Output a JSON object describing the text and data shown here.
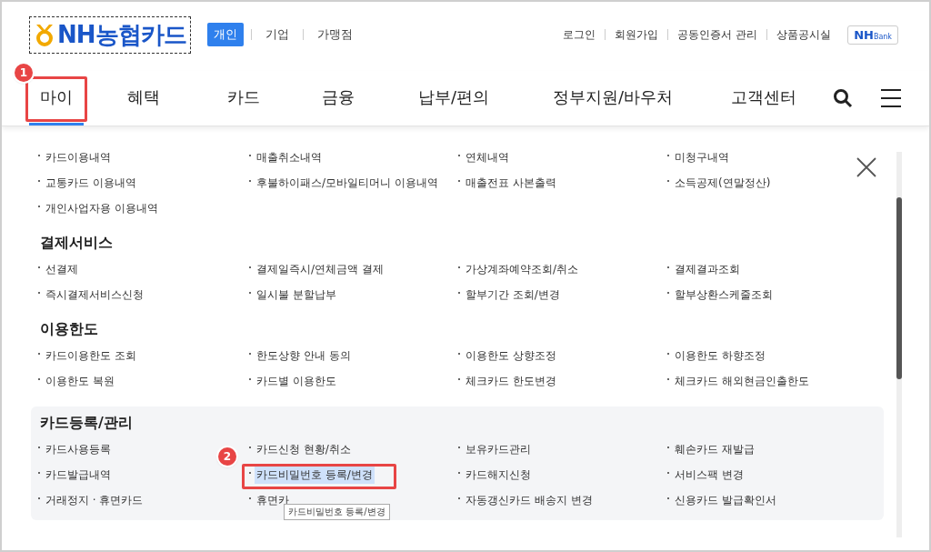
{
  "header": {
    "logo": "NH농협카드",
    "segments": [
      {
        "label": "개인",
        "selected": true
      },
      {
        "label": "기업",
        "selected": false
      },
      {
        "label": "가맹점",
        "selected": false
      }
    ],
    "utility_links": [
      "로그인",
      "회원가입",
      "공동인증서 관리",
      "상품공시실"
    ],
    "bank_badge": {
      "brand": "NH",
      "suffix": "Bank"
    }
  },
  "nav": {
    "items": [
      {
        "label": "마이",
        "selected": true,
        "badge": "1"
      },
      {
        "label": "혜택",
        "selected": false
      },
      {
        "label": "카드",
        "selected": false
      },
      {
        "label": "금융",
        "selected": false
      },
      {
        "label": "납부/편의",
        "selected": false
      },
      {
        "label": "정부지원/바우처",
        "selected": false
      },
      {
        "label": "고객센터",
        "selected": false
      }
    ]
  },
  "menu": {
    "sections": [
      {
        "items": [
          {
            "label": "카드이용내역"
          },
          {
            "label": "매출취소내역"
          },
          {
            "label": "연체내역"
          },
          {
            "label": "미청구내역"
          },
          {
            "label": "교통카드 이용내역"
          },
          {
            "label": "후불하이패스/모바일티머니 이용내역"
          },
          {
            "label": "매출전표 사본출력"
          },
          {
            "label": "소득공제(연말정산)"
          },
          {
            "label": "개인사업자용 이용내역"
          }
        ]
      },
      {
        "title": "결제서비스",
        "items": [
          {
            "label": "선결제"
          },
          {
            "label": "결제일즉시/연체금액 결제"
          },
          {
            "label": "가상계좌예약조회/취소"
          },
          {
            "label": "결제결과조회"
          },
          {
            "label": "즉시결제서비스신청"
          },
          {
            "label": "일시불 분할납부"
          },
          {
            "label": "할부기간 조회/변경"
          },
          {
            "label": "할부상환스케줄조회"
          }
        ]
      },
      {
        "title": "이용한도",
        "items": [
          {
            "label": "카드이용한도 조회"
          },
          {
            "label": "한도상향 안내 동의"
          },
          {
            "label": "이용한도 상향조정"
          },
          {
            "label": "이용한도 하향조정"
          },
          {
            "label": "이용한도 복원"
          },
          {
            "label": "카드별 이용한도"
          },
          {
            "label": "체크카드 한도변경"
          },
          {
            "label": "체크카드 해외현금인출한도"
          }
        ]
      },
      {
        "title": "카드등록/관리",
        "hovered": true,
        "items": [
          {
            "label": "카드사용등록"
          },
          {
            "label": "카드신청 현황/취소"
          },
          {
            "label": "보유카드관리"
          },
          {
            "label": "훼손카드 재발급"
          },
          {
            "label": "카드발급내역"
          },
          {
            "label": "카드비밀번호 등록/변경",
            "highlighted": true,
            "badge": "2"
          },
          {
            "label": "카드해지신청"
          },
          {
            "label": "서비스팩 변경"
          },
          {
            "label": "거래정지 · 휴면카드"
          },
          {
            "label": "휴면카",
            "tooltip": "카드비밀번호 등록/변경"
          },
          {
            "label": "자동갱신카드 배송지 변경"
          },
          {
            "label": "신용카드 발급확인서"
          }
        ]
      }
    ]
  }
}
